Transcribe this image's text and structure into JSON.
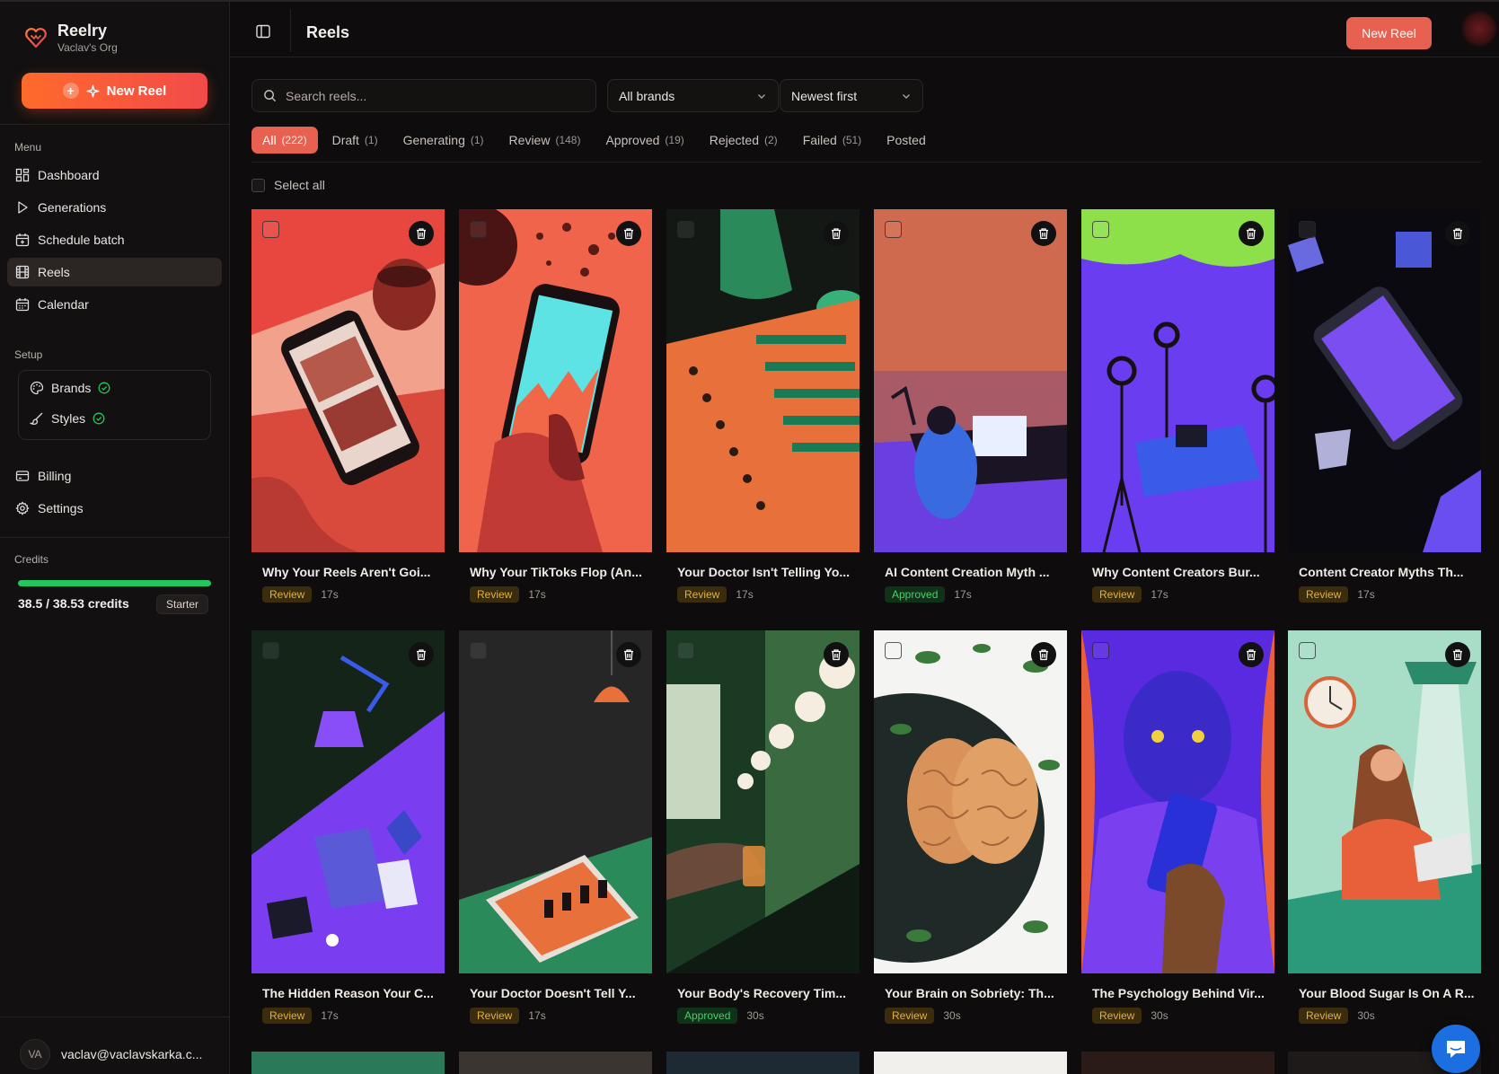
{
  "app": {
    "name": "Reelry",
    "org": "Vaclav's Org"
  },
  "sidebar": {
    "new_reel_label": "New Reel",
    "menu_title": "Menu",
    "menu": [
      {
        "label": "Dashboard",
        "icon": "dashboard-icon"
      },
      {
        "label": "Generations",
        "icon": "play-icon"
      },
      {
        "label": "Schedule batch",
        "icon": "calendar-plus-icon"
      },
      {
        "label": "Reels",
        "icon": "film-icon",
        "active": true
      },
      {
        "label": "Calendar",
        "icon": "calendar-icon"
      }
    ],
    "setup_title": "Setup",
    "setup": [
      {
        "label": "Brands",
        "icon": "palette-icon",
        "status": "complete"
      },
      {
        "label": "Styles",
        "icon": "brush-icon",
        "status": "complete"
      }
    ],
    "extra": [
      {
        "label": "Billing",
        "icon": "credit-card-icon"
      },
      {
        "label": "Settings",
        "icon": "gear-icon"
      }
    ],
    "credits_title": "Credits",
    "credits_text": "38.5 / 38.53 credits",
    "credits_fraction": 0.999,
    "plan": "Starter",
    "user_initials": "VA",
    "user_email": "vaclav@vaclavskarka.c..."
  },
  "header": {
    "title": "Reels",
    "new_reel_label": "New Reel"
  },
  "filters": {
    "search_placeholder": "Search reels...",
    "brand_select": "All brands",
    "sort_select": "Newest first",
    "select_all": "Select all"
  },
  "tabs": [
    {
      "label": "All",
      "count": "(222)",
      "active": true
    },
    {
      "label": "Draft",
      "count": "(1)"
    },
    {
      "label": "Generating",
      "count": "(1)"
    },
    {
      "label": "Review",
      "count": "(148)"
    },
    {
      "label": "Approved",
      "count": "(19)"
    },
    {
      "label": "Rejected",
      "count": "(2)"
    },
    {
      "label": "Failed",
      "count": "(51)"
    },
    {
      "label": "Posted",
      "count": ""
    }
  ],
  "reels": [
    {
      "title": "Why Your Reels Aren't Goi...",
      "status": "Review",
      "age": "17s"
    },
    {
      "title": "Why Your TikToks Flop (An...",
      "status": "Review",
      "age": "17s"
    },
    {
      "title": "Your Doctor Isn't Telling Yo...",
      "status": "Review",
      "age": "17s"
    },
    {
      "title": "AI Content Creation Myth ...",
      "status": "Approved",
      "age": "17s"
    },
    {
      "title": "Why Content Creators Bur...",
      "status": "Review",
      "age": "17s"
    },
    {
      "title": "Content Creator Myths Th...",
      "status": "Review",
      "age": "17s"
    },
    {
      "title": "The Hidden Reason Your C...",
      "status": "Review",
      "age": "17s"
    },
    {
      "title": "Your Doctor Doesn't Tell Y...",
      "status": "Review",
      "age": "17s"
    },
    {
      "title": "Your Body's Recovery Tim...",
      "status": "Approved",
      "age": "30s"
    },
    {
      "title": "Your Brain on Sobriety: Th...",
      "status": "Review",
      "age": "30s"
    },
    {
      "title": "The Psychology Behind Vir...",
      "status": "Review",
      "age": "30s"
    },
    {
      "title": "Your Blood Sugar Is On A R...",
      "status": "Review",
      "age": "30s"
    }
  ],
  "colors": {
    "accent": "#e8604f",
    "review_text": "#e0b043",
    "approved_text": "#4ccf6c",
    "credits_bar": "#22c55e",
    "chat_button": "#1c6fe0"
  }
}
